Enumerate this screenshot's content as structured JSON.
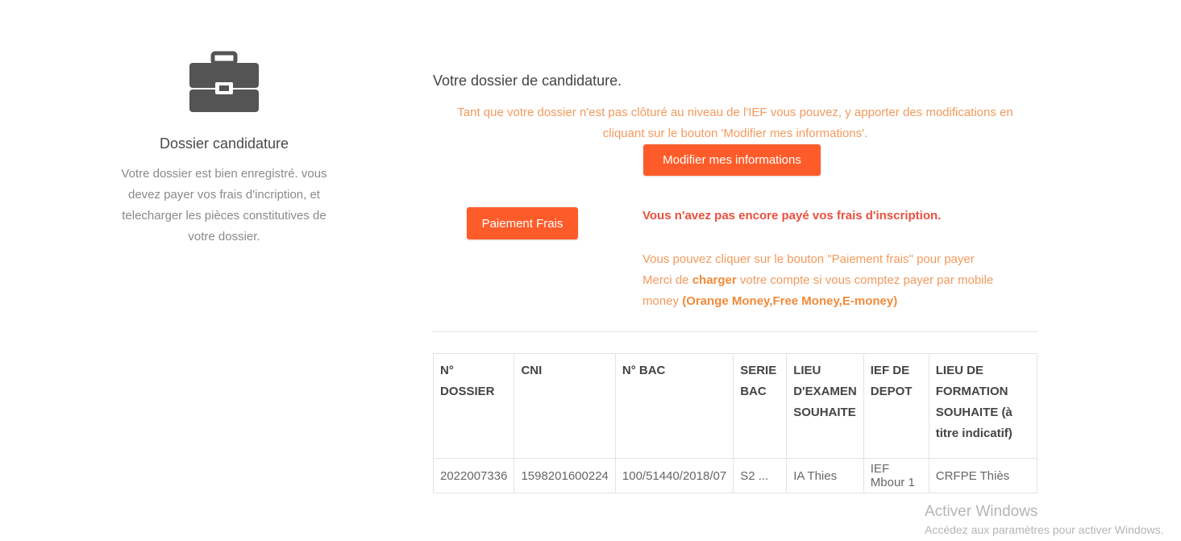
{
  "left_panel": {
    "icon": "briefcase-icon",
    "title": "Dossier candidature",
    "description": "Votre dossier est bien enregistré. vous devez payer vos frais d'incription, et telecharger les pièces constitutives de votre dossier."
  },
  "main": {
    "heading": "Votre dossier de candidature.",
    "info_text": "Tant que votre dossier n'est pas clôturé au niveau de l'IEF vous pouvez, y apporter des modifications en cliquant sur le bouton 'Modifier mes informations'.",
    "modify_button": "Modifier mes informations",
    "pay_button": "Paiement Frais",
    "payment_warning": "Vous n'avez pas encore payé vos frais d'inscription.",
    "payment_info": {
      "line1": "Vous pouvez cliquer sur le bouton \"Paiement frais\" pour payer",
      "merci": "Merci de ",
      "charger": "charger",
      "after_charger": " votre compte si vous comptez payer par mobile money ",
      "operators": "(Orange Money,Free Money,E-money)"
    }
  },
  "table": {
    "headers": [
      "N° DOSSIER",
      "CNI",
      "N° BAC",
      "SERIE BAC",
      "LIEU D'EXAMEN SOUHAITE",
      "IEF DE DEPOT",
      "LIEU DE FORMATION SOUHAITE (à titre indicatif)"
    ],
    "rows": [
      [
        "2022007336",
        "1598201600224",
        "100/51440/2018/07",
        "S2 ...",
        "IA Thies",
        "IEF Mbour 1",
        "CRFPE Thiès"
      ]
    ]
  },
  "watermark": {
    "title": "Activer Windows",
    "subtitle": "Accédez aux paramètres pour activer Windows."
  },
  "colors": {
    "accent_button": "#fd5c2a",
    "info_orange": "#f39a5e",
    "warning_red": "#e8513f",
    "icon_gray": "#545454"
  }
}
